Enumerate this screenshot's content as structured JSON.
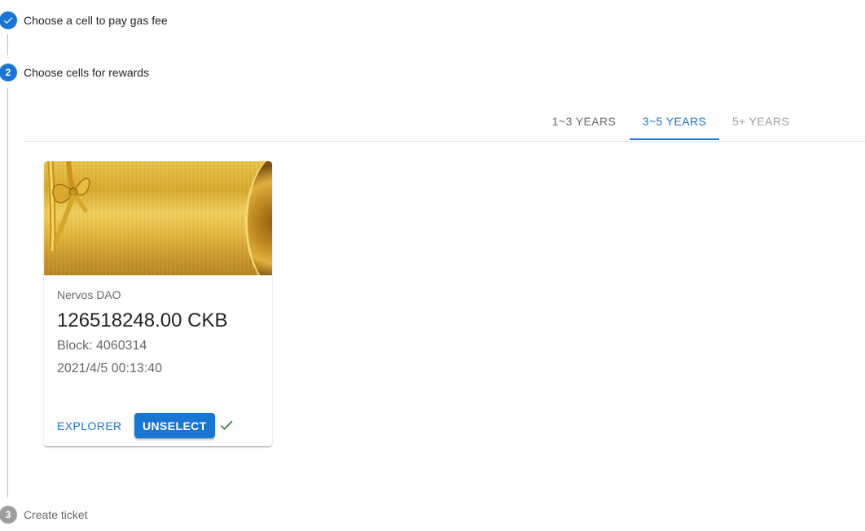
{
  "colors": {
    "primary": "#1976d2",
    "success": "#2e7d32",
    "inactive_step": "#9e9e9e"
  },
  "steps": [
    {
      "label": "Choose a cell to pay gas fee",
      "state": "completed",
      "icon": "check-icon"
    },
    {
      "label": "Choose cells for rewards",
      "state": "active",
      "number": "2"
    },
    {
      "label": "Create ticket",
      "state": "pending",
      "number": "3"
    }
  ],
  "tabs": [
    {
      "label": "1~3 YEARS",
      "state": "default"
    },
    {
      "label": "3~5 YEARS",
      "state": "selected"
    },
    {
      "label": "5+ YEARS",
      "state": "disabled"
    }
  ],
  "card": {
    "overline": "Nervos DAO",
    "amount": "126518248.00 CKB",
    "block": "Block: 4060314",
    "timestamp": "2021/4/5 00:13:40",
    "explorer_label": "EXPLORER",
    "unselect_label": "UNSELECT",
    "selected_indicator_icon": "check-icon"
  }
}
